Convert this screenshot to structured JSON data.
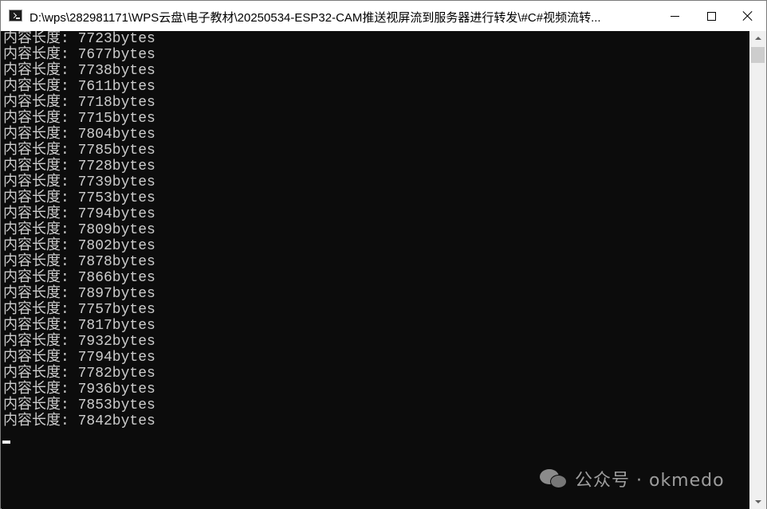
{
  "window": {
    "title": "D:\\wps\\282981171\\WPS云盘\\电子教材\\20250534-ESP32-CAM推送视屏流到服务器进行转发\\#C#视频流转..."
  },
  "console": {
    "lines": [
      "内容长度: 7723bytes",
      "内容长度: 7677bytes",
      "内容长度: 7738bytes",
      "内容长度: 7611bytes",
      "内容长度: 7718bytes",
      "内容长度: 7715bytes",
      "内容长度: 7804bytes",
      "内容长度: 7785bytes",
      "内容长度: 7728bytes",
      "内容长度: 7739bytes",
      "内容长度: 7753bytes",
      "内容长度: 7794bytes",
      "内容长度: 7809bytes",
      "内容长度: 7802bytes",
      "内容长度: 7878bytes",
      "内容长度: 7866bytes",
      "内容长度: 7897bytes",
      "内容长度: 7757bytes",
      "内容长度: 7817bytes",
      "内容长度: 7932bytes",
      "内容长度: 7794bytes",
      "内容长度: 7782bytes",
      "内容长度: 7936bytes",
      "内容长度: 7853bytes",
      "内容长度: 7842bytes"
    ]
  },
  "watermark": {
    "text": "公众号 · okmedo",
    "icon": "wechat-icon"
  },
  "colors": {
    "console_bg": "#0c0c0c",
    "console_text": "#cccccc",
    "titlebar_bg": "#ffffff",
    "scrollbar_bg": "#f0f0f0"
  }
}
